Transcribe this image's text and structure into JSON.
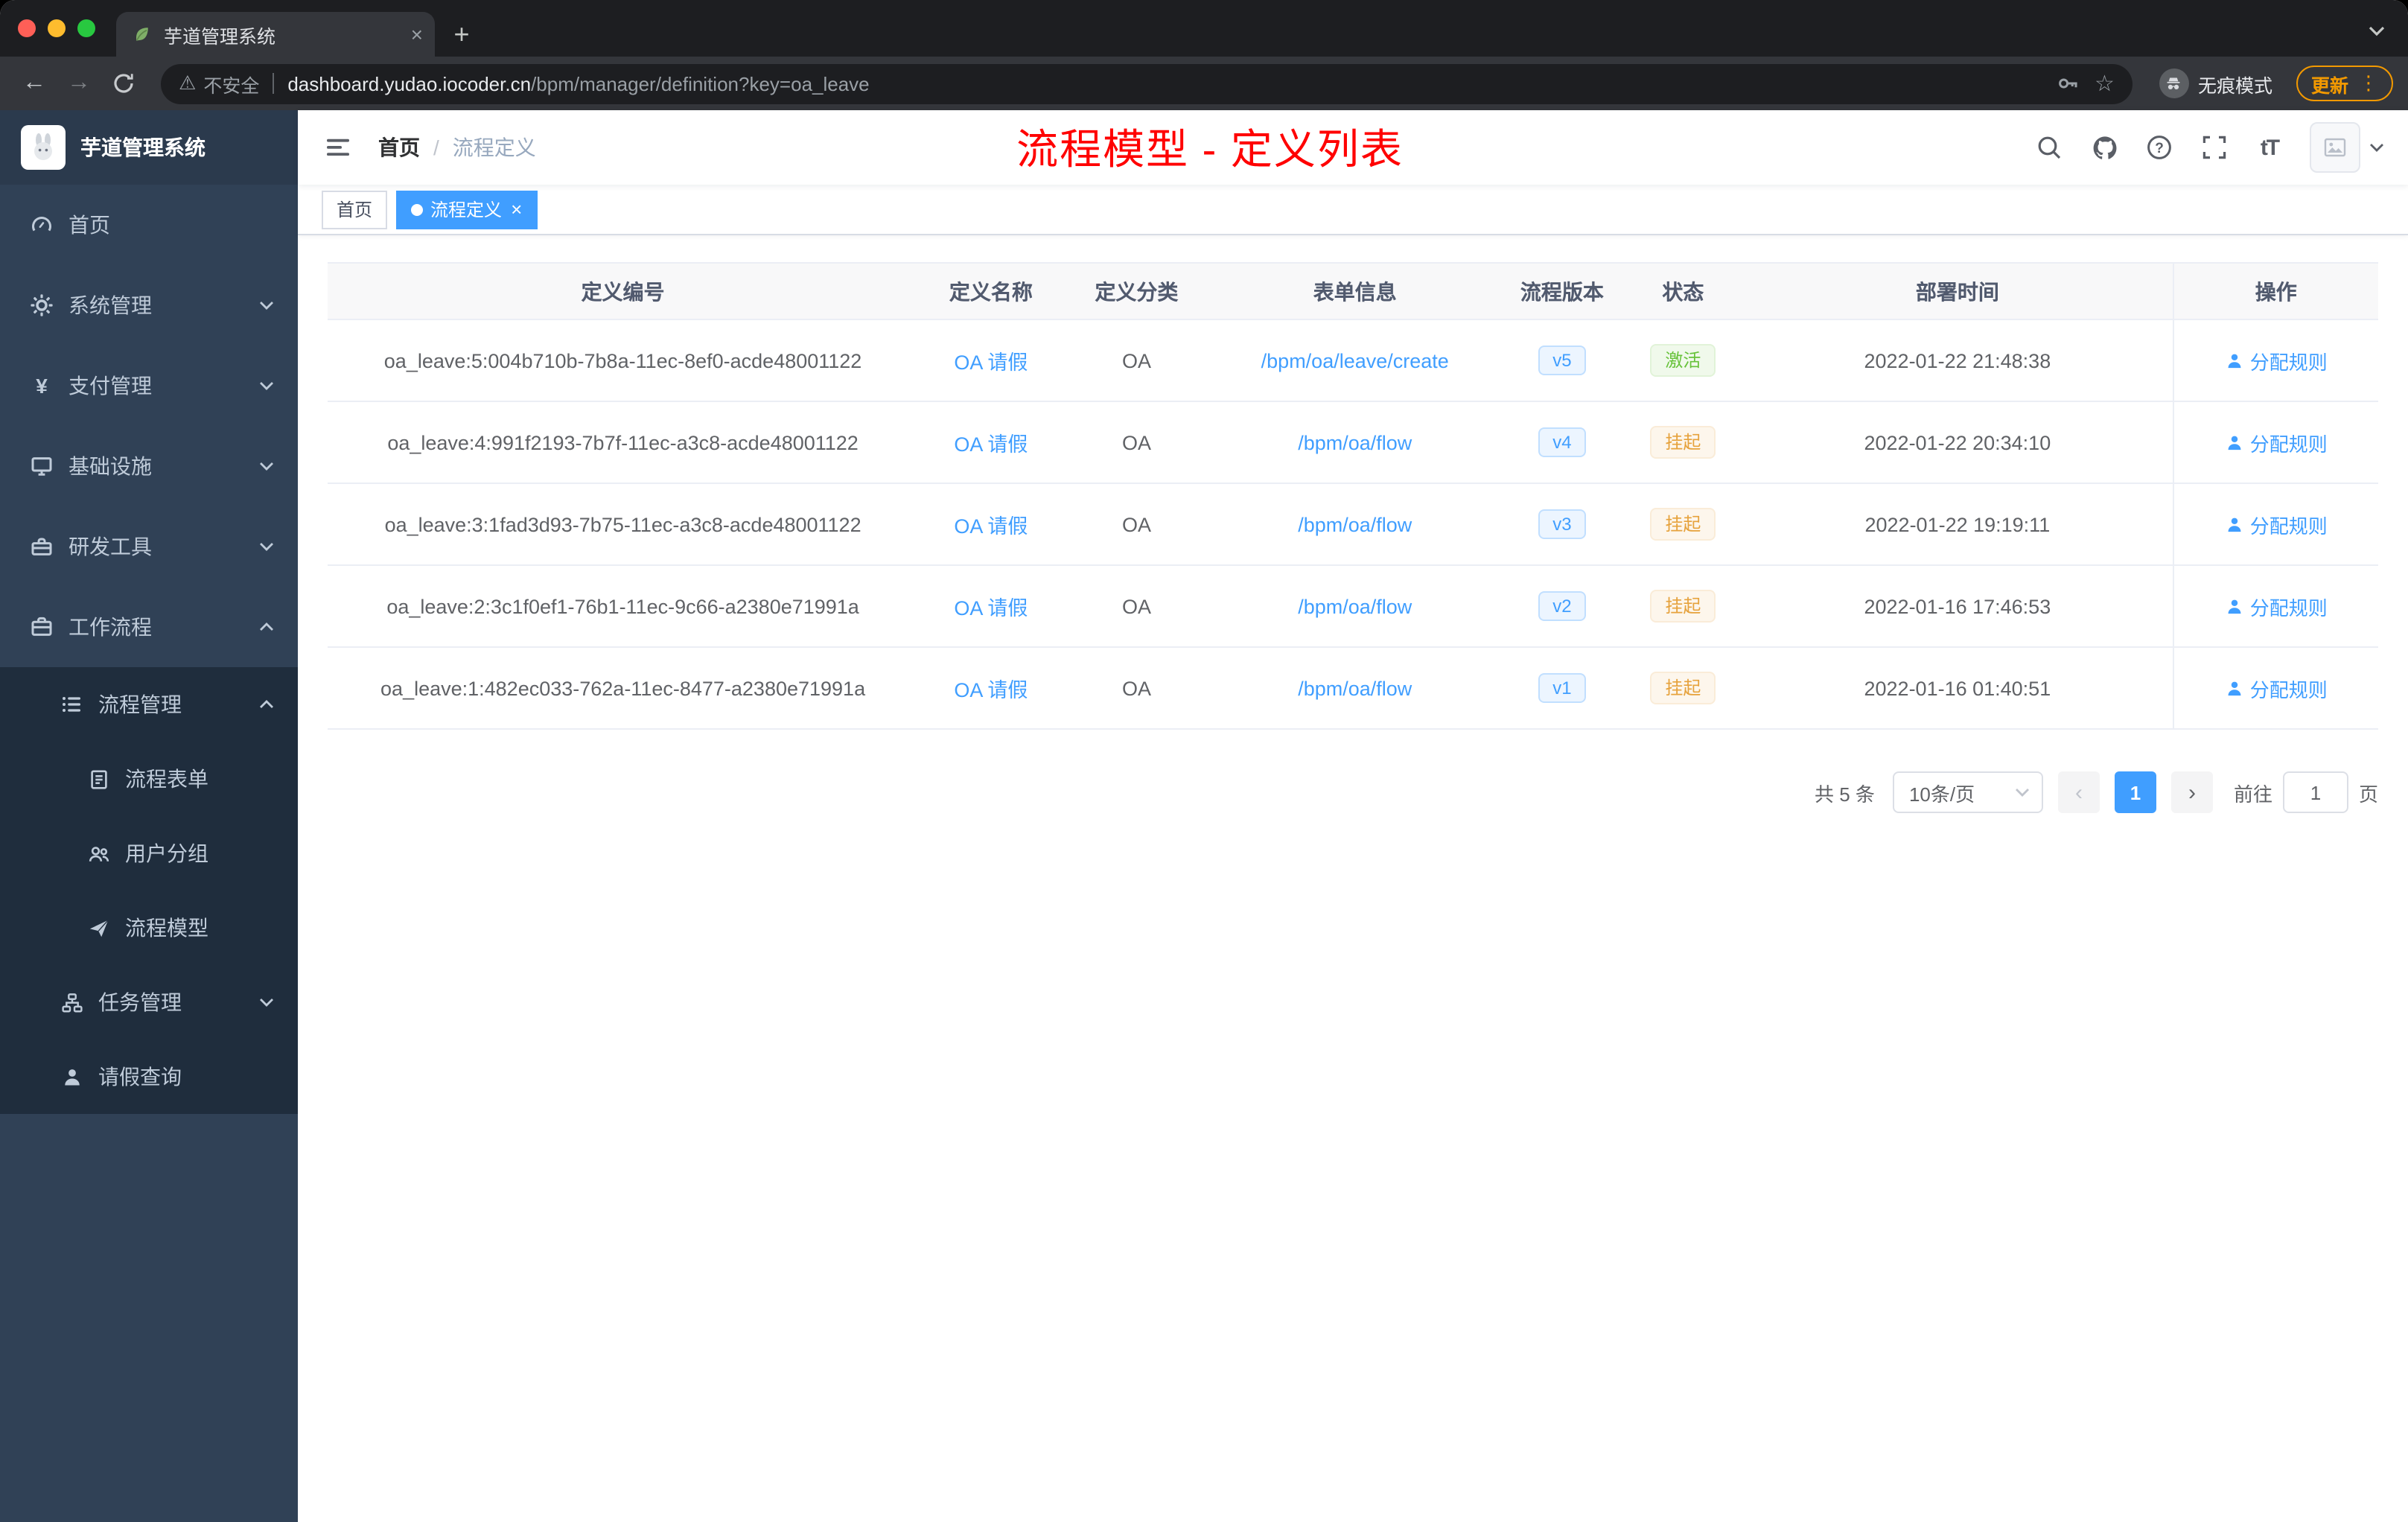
{
  "browser": {
    "tab_title": "芋道管理系统",
    "security_label": "不安全",
    "url_host": "dashboard.yudao.iocoder.cn",
    "url_path": "/bpm/manager/definition?key=oa_leave",
    "incognito_label": "无痕模式",
    "update_label": "更新"
  },
  "icons": {
    "close": "×",
    "plus": "+",
    "back": "←",
    "forward": "→",
    "star": "☆",
    "warning": "⚠",
    "dots": "⋮",
    "prev": "‹",
    "next": "›",
    "yen": "¥"
  },
  "sidebar": {
    "logo_title": "芋道管理系统",
    "items": [
      {
        "label": "首页"
      },
      {
        "label": "系统管理"
      },
      {
        "label": "支付管理"
      },
      {
        "label": "基础设施"
      },
      {
        "label": "研发工具"
      },
      {
        "label": "工作流程"
      },
      {
        "label": "流程管理"
      },
      {
        "label": "流程表单"
      },
      {
        "label": "用户分组"
      },
      {
        "label": "流程模型"
      },
      {
        "label": "任务管理"
      },
      {
        "label": "请假查询"
      }
    ]
  },
  "topbar": {
    "breadcrumb_home": "首页",
    "breadcrumb_sep": "/",
    "breadcrumb_current": "流程定义",
    "annotation": "流程模型 - 定义列表",
    "font_icon": "tT"
  },
  "tags": {
    "home": "首页",
    "active": "流程定义"
  },
  "table": {
    "columns": [
      "定义编号",
      "定义名称",
      "定义分类",
      "表单信息",
      "流程版本",
      "状态",
      "部署时间",
      "操作"
    ],
    "rows": [
      {
        "id": "oa_leave:5:004b710b-7b8a-11ec-8ef0-acde48001122",
        "name": "OA 请假",
        "category": "OA",
        "form": "/bpm/oa/leave/create",
        "version": "v5",
        "status": "激活",
        "time": "2022-01-22 21:48:38",
        "action": "分配规则"
      },
      {
        "id": "oa_leave:4:991f2193-7b7f-11ec-a3c8-acde48001122",
        "name": "OA 请假",
        "category": "OA",
        "form": "/bpm/oa/flow",
        "version": "v4",
        "status": "挂起",
        "time": "2022-01-22 20:34:10",
        "action": "分配规则"
      },
      {
        "id": "oa_leave:3:1fad3d93-7b75-11ec-a3c8-acde48001122",
        "name": "OA 请假",
        "category": "OA",
        "form": "/bpm/oa/flow",
        "version": "v3",
        "status": "挂起",
        "time": "2022-01-22 19:19:11",
        "action": "分配规则"
      },
      {
        "id": "oa_leave:2:3c1f0ef1-76b1-11ec-9c66-a2380e71991a",
        "name": "OA 请假",
        "category": "OA",
        "form": "/bpm/oa/flow",
        "version": "v2",
        "status": "挂起",
        "time": "2022-01-16 17:46:53",
        "action": "分配规则"
      },
      {
        "id": "oa_leave:1:482ec033-762a-11ec-8477-a2380e71991a",
        "name": "OA 请假",
        "category": "OA",
        "form": "/bpm/oa/flow",
        "version": "v1",
        "status": "挂起",
        "time": "2022-01-16 01:40:51",
        "action": "分配规则"
      }
    ]
  },
  "pagination": {
    "total": "共 5 条",
    "page_size": "10条/页",
    "page": "1",
    "goto": "前往",
    "goto_value": "1",
    "unit": "页"
  },
  "colors": {
    "accent": "#409eff",
    "success": "#67c23a",
    "warning": "#e6a23c",
    "annotation_red": "#ff0000",
    "sidebar_bg": "#304156",
    "submenu_bg": "#1f2d3d",
    "active_tag": "#409eff",
    "update_orange": "#f29900"
  }
}
